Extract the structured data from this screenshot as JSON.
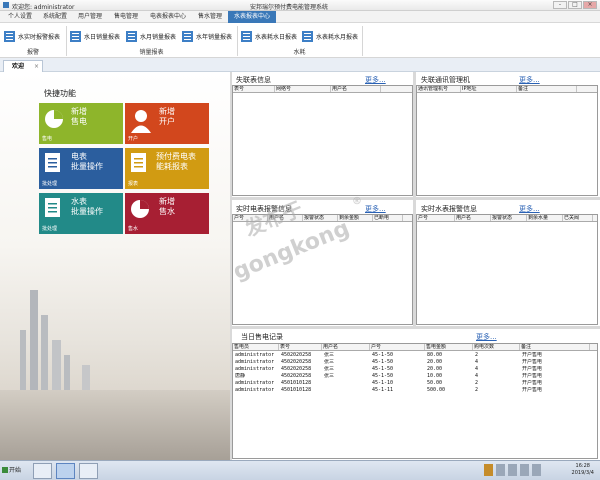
{
  "window": {
    "title": "安邦瑞尔预付费电能管理系统",
    "login": "欢迎您: administrator",
    "controls": [
      "-",
      "□",
      "×"
    ]
  },
  "menu": {
    "items": [
      "个人设置",
      "系统配置",
      "用户管理",
      "售电管理",
      "电表报表中心",
      "售水管理",
      "水表报表中心"
    ],
    "active": 6
  },
  "ribbon": {
    "buttons": [
      "水实时报警报表",
      "水日销量报表",
      "水月销量报表",
      "水年销量报表",
      "水表耗水日报表",
      "水表耗水月报表"
    ],
    "groups": [
      "报警",
      "销量报表",
      "水耗"
    ]
  },
  "tabs": {
    "active": "欢迎",
    "close": "×"
  },
  "quick": {
    "title": "快捷功能",
    "tiles": [
      {
        "text": "新增\n售电",
        "label": "售电",
        "color": "#8eb52b",
        "icon": "pie-chart-icon"
      },
      {
        "text": "新增\n开户",
        "label": "开户",
        "color": "#d2471d",
        "icon": "user-icon"
      },
      {
        "text": "电表\n批量操作",
        "label": "批处理",
        "color": "#2b5e9e",
        "icon": "document-icon"
      },
      {
        "text": "预付费电表\n能耗报表",
        "label": "报表",
        "color": "#d19b12",
        "icon": "document-icon"
      },
      {
        "text": "水表\n批量操作",
        "label": "批处理",
        "color": "#228a88",
        "icon": "document-icon"
      },
      {
        "text": "新增\n售水",
        "label": "售水",
        "color": "#a71f33",
        "icon": "pie-chart-icon"
      }
    ]
  },
  "panels": {
    "lost": {
      "title": "失联表信息",
      "more": "更多...",
      "cols": [
        "表号",
        "网络号",
        "用户名"
      ]
    },
    "comm": {
      "title": "失联通讯管理机",
      "more": "更多...",
      "cols": [
        "通讯管理机号",
        "IP地址",
        "备注"
      ]
    },
    "ealarm": {
      "title": "实时电表报警信息",
      "more": "更多...",
      "cols": [
        "户号",
        "用户名",
        "报警状态",
        "剩余金额",
        "已断电"
      ]
    },
    "walarm": {
      "title": "实时水表报警信息",
      "more": "更多...",
      "cols": [
        "户号",
        "用户名",
        "报警状态",
        "剩余水量",
        "已关阀"
      ]
    },
    "sales": {
      "title": "当日售电记录",
      "more": "更多...",
      "cols": [
        "售电员",
        "表号",
        "用户名",
        "户号",
        "售电金额",
        "购电次数",
        "备注"
      ],
      "rows": [
        [
          "administrator",
          "4502020258",
          "张三",
          "45-1-50",
          "80.00",
          "2",
          "开户售电"
        ],
        [
          "administrator",
          "4502020258",
          "张三",
          "45-1-50",
          "20.00",
          "4",
          "开户售电"
        ],
        [
          "administrator",
          "4502020258",
          "张三",
          "45-1-50",
          "20.00",
          "4",
          "开户售电"
        ],
        [
          "唐静",
          "4502020258",
          "张三",
          "45-1-50",
          "10.00",
          "4",
          "开户售电"
        ],
        [
          "administrator",
          "4501010128",
          "",
          "45-1-10",
          "50.00",
          "2",
          "开户售电"
        ],
        [
          "administrator",
          "4501010128",
          "",
          "45-1-11",
          "500.00",
          "2",
          "开户售电"
        ]
      ]
    }
  },
  "taskbar": {
    "start": "开始",
    "time": "16:28",
    "date": "2019/3/4"
  },
  "watermark": {
    "cn": "发布于",
    "en": "gongkong",
    "reg": "®"
  }
}
